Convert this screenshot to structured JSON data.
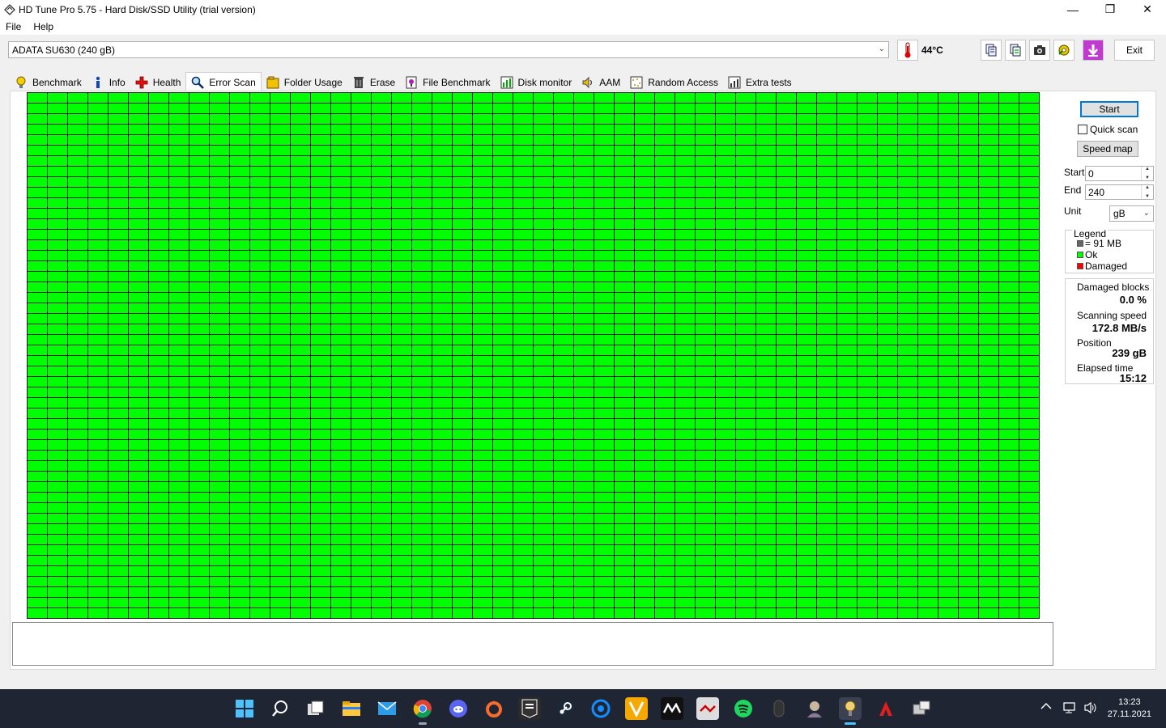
{
  "window": {
    "title": "HD Tune Pro 5.75 - Hard Disk/SSD Utility (trial version)",
    "minimize": "—",
    "maximize": "❐",
    "close": "✕"
  },
  "menu": [
    "File",
    "Help"
  ],
  "drive": {
    "selected": "ADATA SU630 (240 gB)"
  },
  "temperature": "44°C",
  "toolbar": {
    "exit": "Exit",
    "icons": [
      "copy-text-icon",
      "copy-info-icon",
      "screenshot-icon",
      "options-icon",
      "save-icon"
    ]
  },
  "tabs": [
    {
      "label": "Benchmark",
      "icon": "benchmark-icon",
      "active": false
    },
    {
      "label": "Info",
      "icon": "info-icon",
      "active": false
    },
    {
      "label": "Health",
      "icon": "health-icon",
      "active": false
    },
    {
      "label": "Error Scan",
      "icon": "error-scan-icon",
      "active": true
    },
    {
      "label": "Folder Usage",
      "icon": "folder-usage-icon",
      "active": false
    },
    {
      "label": "Erase",
      "icon": "erase-icon",
      "active": false
    },
    {
      "label": "File Benchmark",
      "icon": "file-benchmark-icon",
      "active": false
    },
    {
      "label": "Disk monitor",
      "icon": "disk-monitor-icon",
      "active": false
    },
    {
      "label": "AAM",
      "icon": "aam-icon",
      "active": false
    },
    {
      "label": "Random Access",
      "icon": "random-access-icon",
      "active": false
    },
    {
      "label": "Extra tests",
      "icon": "extra-tests-icon",
      "active": false
    }
  ],
  "scan": {
    "start_button": "Start",
    "quick_scan_label": "Quick scan",
    "quick_scan_checked": false,
    "speed_map_button": "Speed map",
    "start_label": "Start",
    "start_value": "0",
    "end_label": "End",
    "end_value": "240",
    "unit_label": "Unit",
    "unit_value": "gB",
    "block_color_ok": "#00ff00",
    "block_color_damaged": "#ff0000"
  },
  "legend": {
    "title": "Legend",
    "block_size": "= 91 MB",
    "ok": "Ok",
    "damaged": "Damaged"
  },
  "stats": {
    "damaged_label": "Damaged blocks",
    "damaged_value": "0.0 %",
    "speed_label": "Scanning speed",
    "speed_value": "172.8 MB/s",
    "position_label": "Position",
    "position_value": "239 gB",
    "elapsed_label": "Elapsed time",
    "elapsed_value": "15:12"
  },
  "taskbar": {
    "apps": [
      "start-icon",
      "search-icon",
      "task-view-icon",
      "file-explorer-icon",
      "mail-icon",
      "chrome-icon",
      "discord-icon",
      "origin-icon",
      "epic-games-icon",
      "steam-icon",
      "battlenet-icon",
      "vortex-icon",
      "msi-icon",
      "msi-afterburner-icon",
      "spotify-icon",
      "mouse-icon",
      "avatar-app-icon",
      "hd-tune-icon",
      "adobe-icon",
      "network-tool-icon"
    ],
    "time": "13:23",
    "date": "27.11.2021"
  }
}
